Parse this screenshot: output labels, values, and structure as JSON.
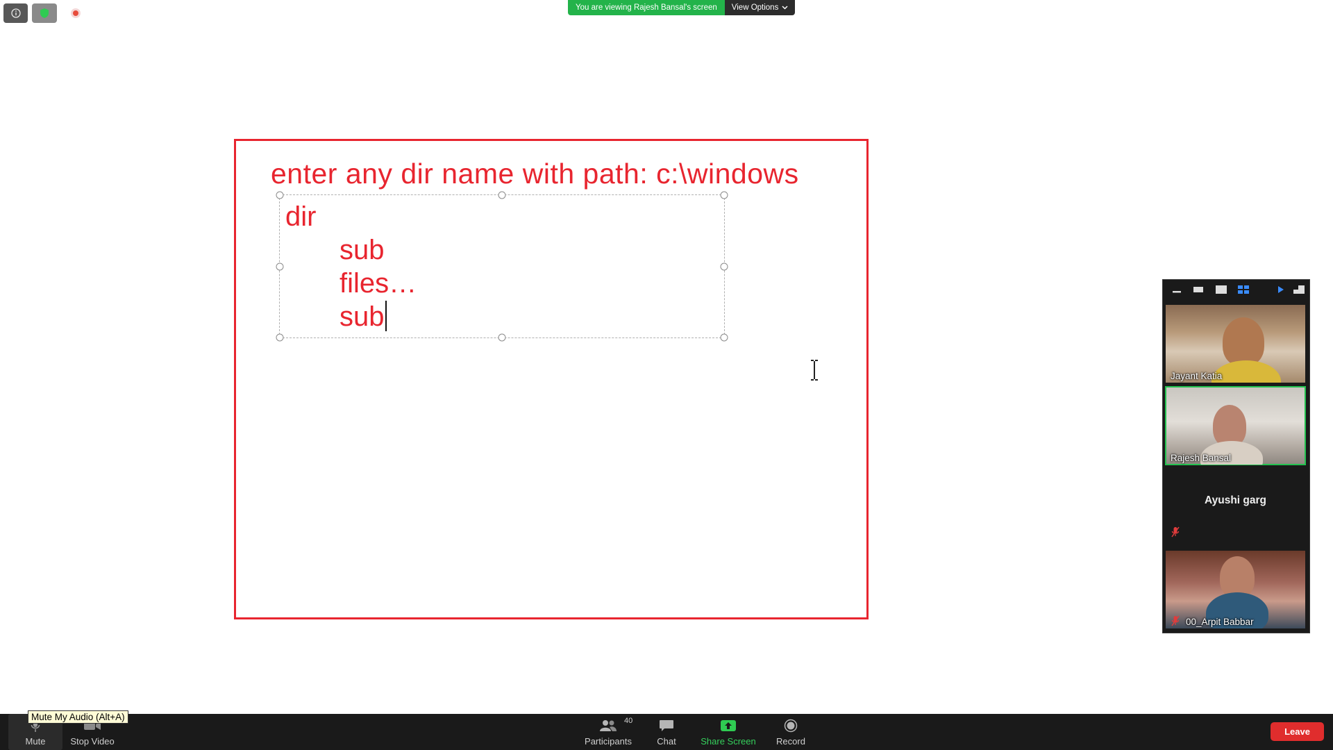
{
  "banner": {
    "viewing_text": "You are viewing Rajesh Bansal's screen",
    "view_options_label": "View Options"
  },
  "slide": {
    "title": "enter any dir name with path: c:\\windows",
    "lines": [
      "dir",
      "sub",
      "files…",
      "sub"
    ]
  },
  "participants_panel": {
    "tiles": [
      {
        "name": "Jayant Katia",
        "video": true,
        "active_speaker": false,
        "muted": false
      },
      {
        "name": "Rajesh Bansal",
        "video": true,
        "active_speaker": true,
        "muted": false
      },
      {
        "name": "Ayushi garg",
        "video": false,
        "active_speaker": false,
        "muted": true
      },
      {
        "name": "00_Arpit Babbar",
        "video": true,
        "active_speaker": false,
        "muted": true
      }
    ]
  },
  "toolbar": {
    "mute_label": "Mute",
    "stop_video_label": "Stop Video",
    "participants_label": "Participants",
    "participant_count": "40",
    "chat_label": "Chat",
    "share_label": "Share Screen",
    "record_label": "Record",
    "leave_label": "Leave"
  },
  "tooltip": {
    "text": "Mute My Audio (Alt+A)"
  },
  "colors": {
    "slide_red": "#e8252f",
    "banner_green": "#23b34a",
    "share_green": "#35d05c",
    "leave_red": "#e02d2d",
    "active_speaker_border": "#23c24f"
  },
  "icons": [
    "info-icon",
    "shield-icon",
    "recording-icon",
    "chevron-down-icon",
    "microphone-icon",
    "video-camera-icon",
    "participants-icon",
    "chat-icon",
    "share-screen-icon",
    "record-icon",
    "muted-mic-icon",
    "text-cursor-icon"
  ]
}
